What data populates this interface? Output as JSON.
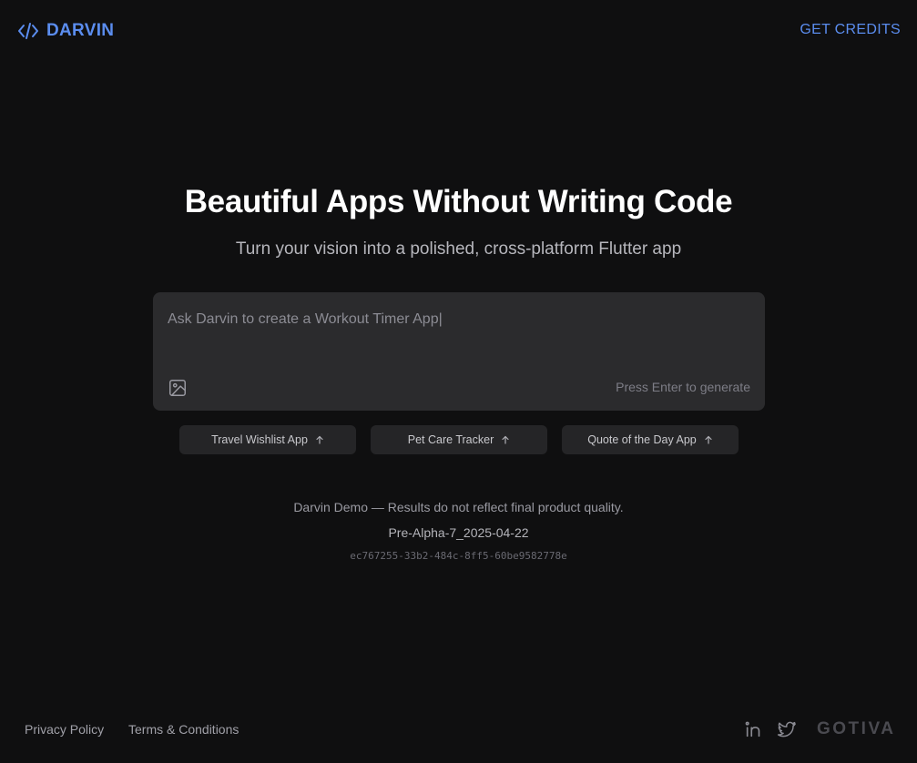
{
  "header": {
    "logo_text": "DARVIN",
    "logo_icon": "code-brackets-icon",
    "get_credits_label": "GET CREDITS"
  },
  "hero": {
    "title": "Beautiful Apps Without Writing Code",
    "subtitle": "Turn your vision into a polished, cross-platform Flutter app"
  },
  "prompt": {
    "placeholder": "Ask Darvin to create a Workout Timer App|",
    "value": "",
    "image_icon": "image-icon",
    "hint": "Press Enter to generate"
  },
  "suggestions": [
    {
      "label": "Travel Wishlist App",
      "icon": "arrow-up-icon"
    },
    {
      "label": "Pet Care Tracker",
      "icon": "arrow-up-icon"
    },
    {
      "label": "Quote of the Day App",
      "icon": "arrow-up-icon"
    }
  ],
  "meta": {
    "disclaimer": "Darvin Demo — Results do not reflect final product quality.",
    "version": "Pre-Alpha-7_2025-04-22",
    "hash": "ec767255-33b2-484c-8ff5-60be9582778e"
  },
  "footer": {
    "privacy_label": "Privacy Policy",
    "terms_label": "Terms & Conditions",
    "brand": "GOTIVA",
    "social_icons": [
      "linkedin-icon",
      "twitter-icon"
    ]
  },
  "colors": {
    "background": "#0f0f10",
    "accent": "#5b8def",
    "panel": "#2b2b2d",
    "chip": "#252527"
  }
}
